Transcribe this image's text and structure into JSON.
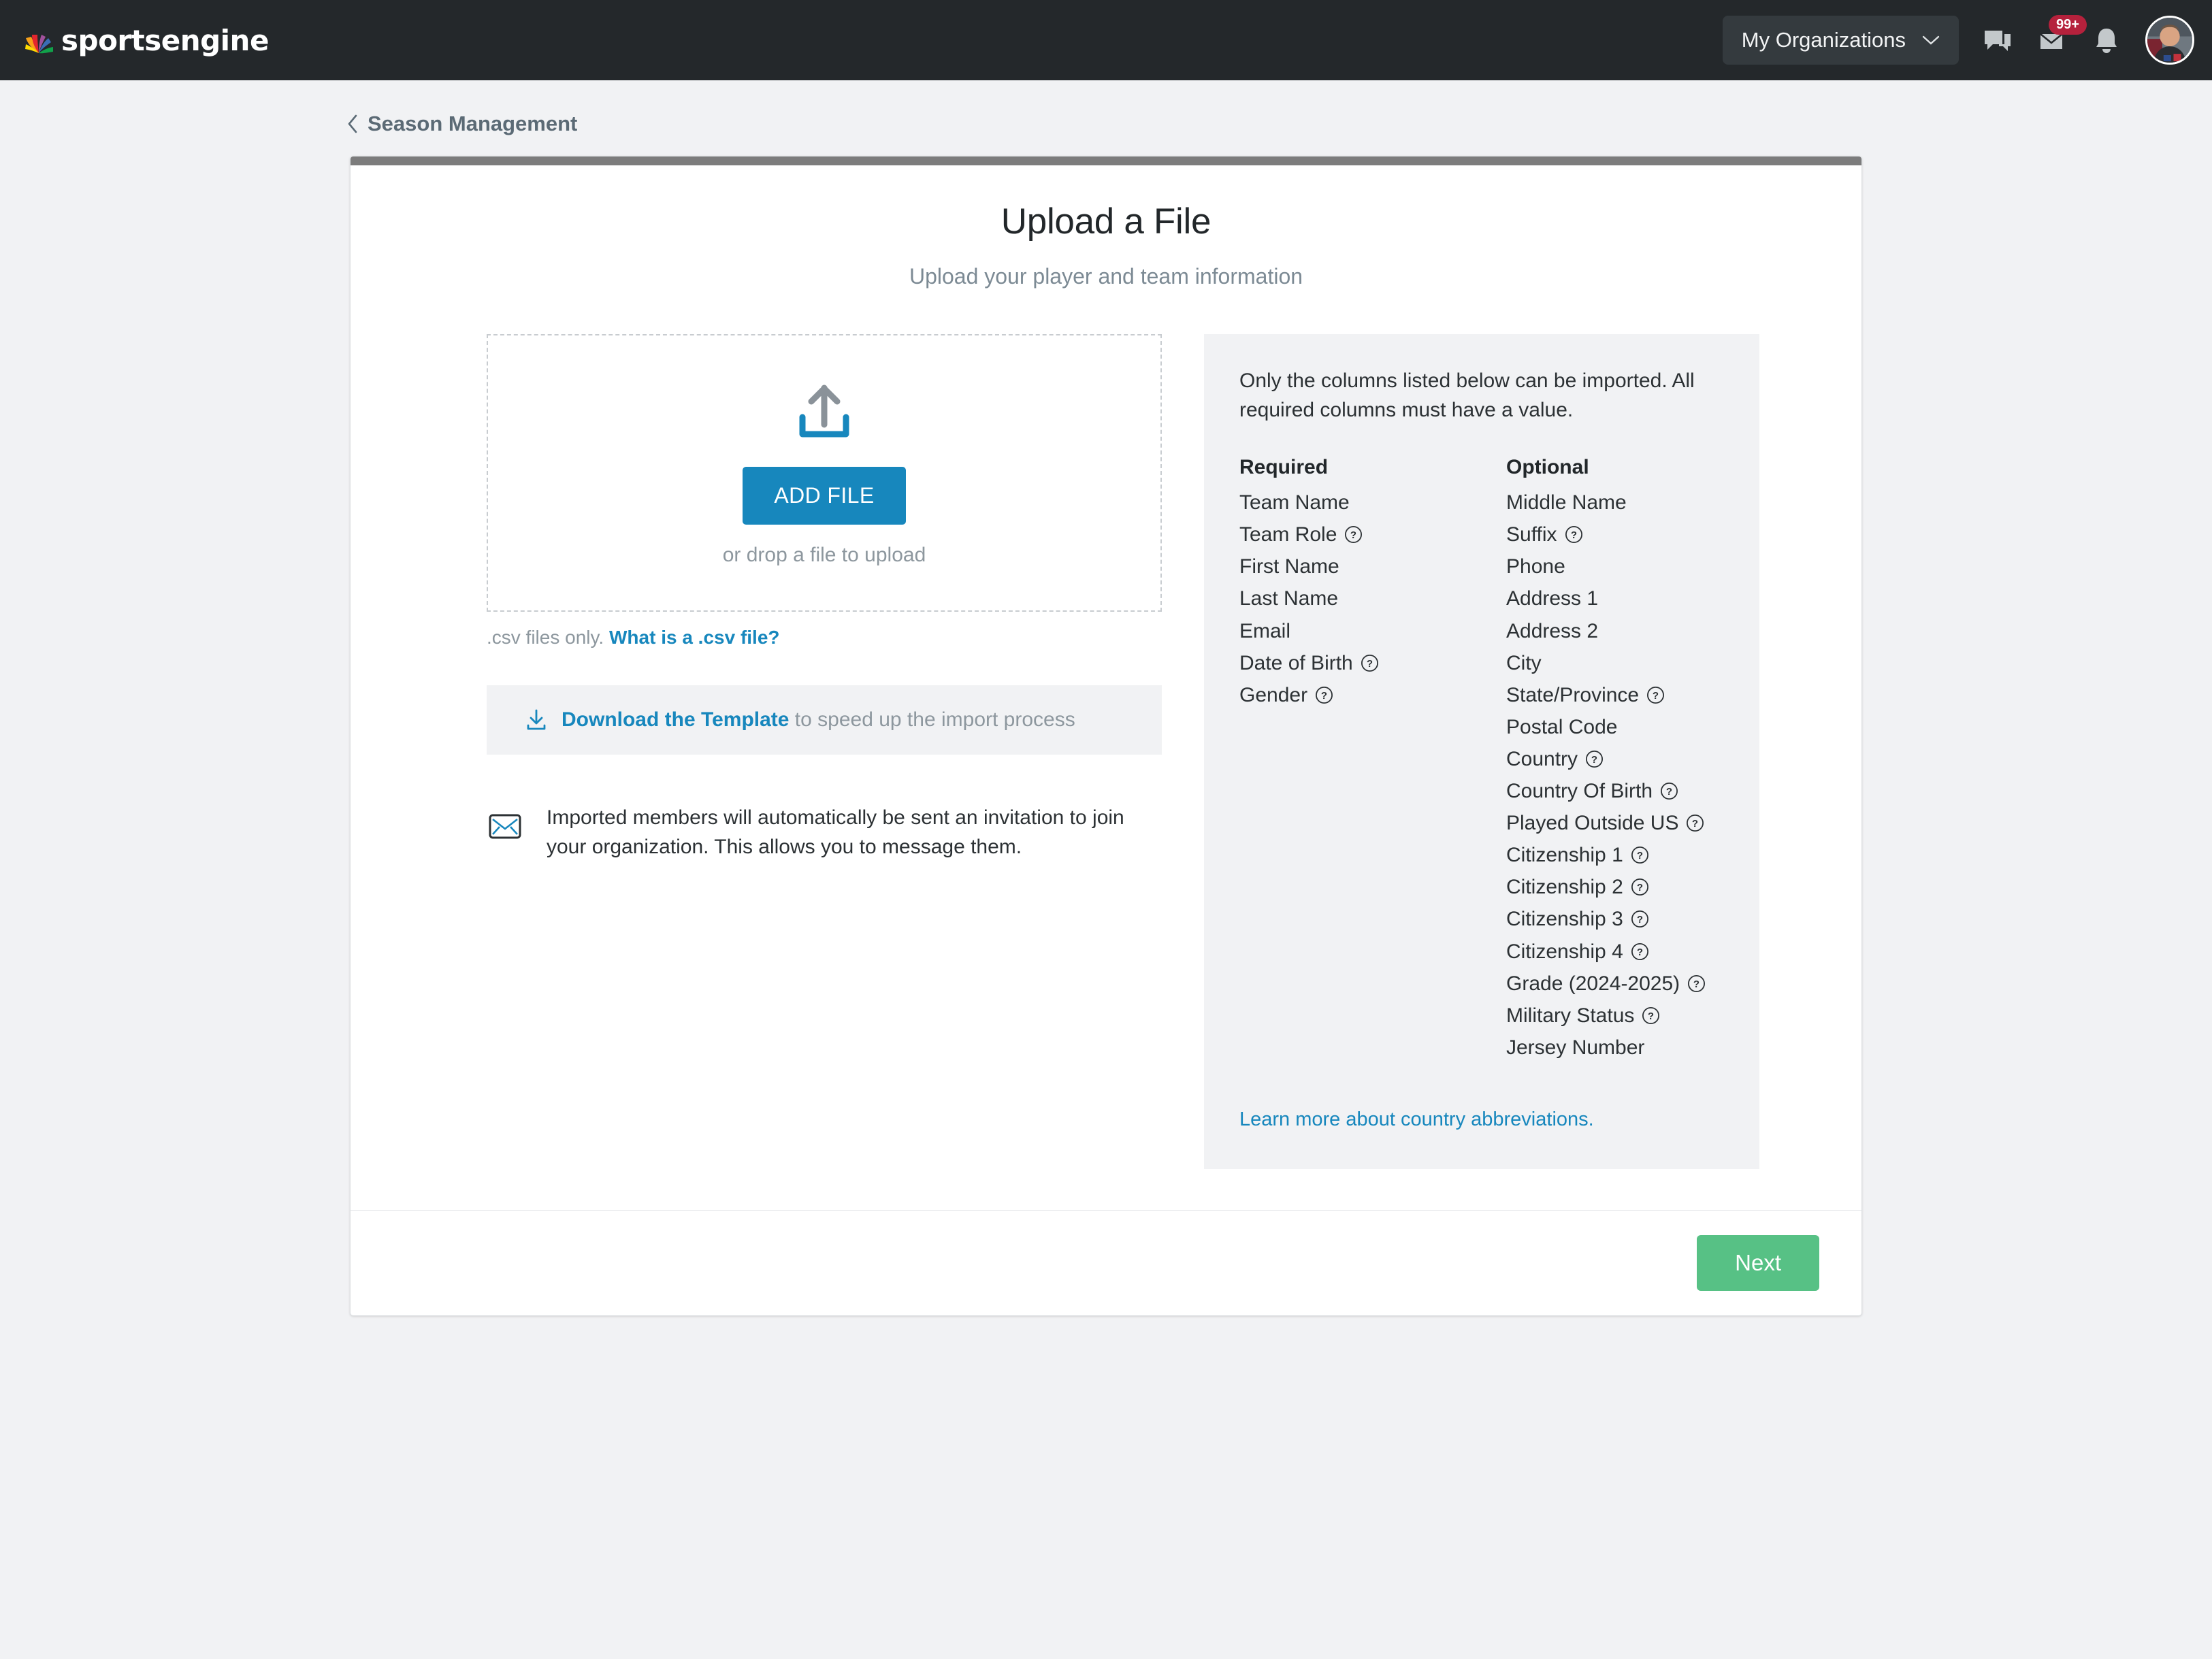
{
  "header": {
    "brand_name": "sportsengine",
    "org_button_label": "My Organizations",
    "icons": {
      "chat": "chat-icon",
      "mail": "mail-icon",
      "bell": "bell-icon",
      "avatar": "avatar"
    },
    "mail_badge": "99+"
  },
  "breadcrumb": {
    "label": "Season Management"
  },
  "card": {
    "title": "Upload a File",
    "subtitle": "Upload your player and team information",
    "accent_color": "#7c7c7c"
  },
  "upload": {
    "button_label": "ADD FILE",
    "drop_hint": "or drop a file to upload",
    "csv_note_prefix": ".csv files only. ",
    "csv_note_link": "What is a .csv file?",
    "template_link": "Download the Template",
    "template_rest": " to speed up the import process",
    "invite_text": "Imported members will automatically be sent an invitation to join your organization. This allows you to message them.",
    "icon_arrow_color": "#8a9299",
    "icon_tray_color": "#1787bd",
    "button_color": "#1787bd"
  },
  "panel": {
    "intro": "Only the columns listed below can be imported. All required columns must have a value.",
    "required_heading": "Required",
    "optional_heading": "Optional",
    "required_fields": [
      {
        "label": "Team Name",
        "help": false
      },
      {
        "label": "Team Role",
        "help": true
      },
      {
        "label": "First Name",
        "help": false
      },
      {
        "label": "Last Name",
        "help": false
      },
      {
        "label": "Email",
        "help": false
      },
      {
        "label": "Date of Birth",
        "help": true
      },
      {
        "label": "Gender",
        "help": true
      }
    ],
    "optional_fields": [
      {
        "label": "Middle Name",
        "help": false
      },
      {
        "label": "Suffix",
        "help": true
      },
      {
        "label": "Phone",
        "help": false
      },
      {
        "label": "Address 1",
        "help": false
      },
      {
        "label": "Address 2",
        "help": false
      },
      {
        "label": "City",
        "help": false
      },
      {
        "label": "State/Province",
        "help": true
      },
      {
        "label": "Postal Code",
        "help": false
      },
      {
        "label": "Country",
        "help": true
      },
      {
        "label": "Country Of Birth",
        "help": true
      },
      {
        "label": "Played Outside US",
        "help": true
      },
      {
        "label": "Citizenship 1",
        "help": true
      },
      {
        "label": "Citizenship 2",
        "help": true
      },
      {
        "label": "Citizenship 3",
        "help": true
      },
      {
        "label": "Citizenship 4",
        "help": true
      },
      {
        "label": "Grade (2024-2025)",
        "help": true
      },
      {
        "label": "Military Status",
        "help": true
      },
      {
        "label": "Jersey Number",
        "help": false
      }
    ],
    "learn_more": "Learn more about country abbreviations."
  },
  "footer": {
    "next_label": "Next",
    "next_color": "#57c185"
  }
}
